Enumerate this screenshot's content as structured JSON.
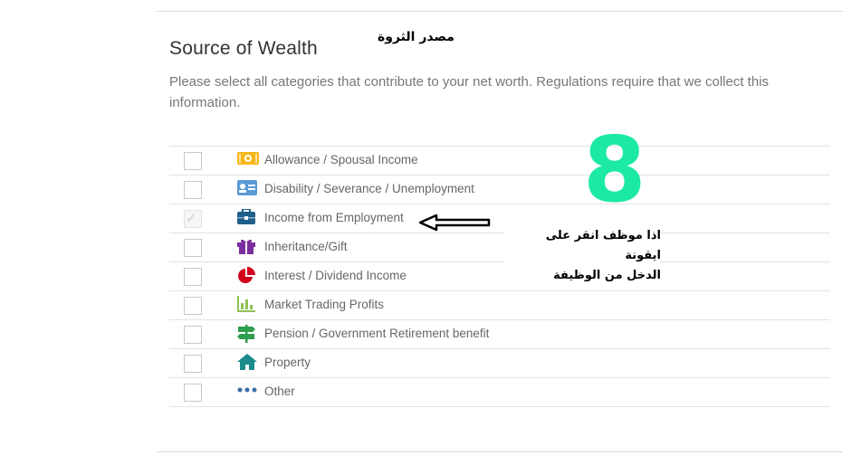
{
  "section": {
    "title": "Source of Wealth",
    "title_ar": "مصدر الثروة",
    "description": "Please select all categories that contribute to your net worth. Regulations require that we collect this information."
  },
  "options": [
    {
      "label": "Allowance / Spousal Income",
      "icon": "banknote-icon",
      "checked": false
    },
    {
      "label": "Disability / Severance / Unemployment",
      "icon": "id-card-icon",
      "checked": false
    },
    {
      "label": "Income from Employment",
      "icon": "briefcase-icon",
      "checked": true
    },
    {
      "label": "Inheritance/Gift",
      "icon": "gift-icon",
      "checked": false
    },
    {
      "label": "Interest / Dividend Income",
      "icon": "pie-chart-icon",
      "checked": false
    },
    {
      "label": "Market Trading Profits",
      "icon": "bar-chart-icon",
      "checked": false
    },
    {
      "label": "Pension / Government Retirement benefit",
      "icon": "signpost-icon",
      "checked": false
    },
    {
      "label": "Property",
      "icon": "house-icon",
      "checked": false
    },
    {
      "label": "Other",
      "icon": "more-dots-icon",
      "checked": false
    }
  ],
  "annotation": {
    "step_number": "8",
    "note_line1": "اذا موظف انقر على ايقونة",
    "note_line2": "الدخل من الوظيفة"
  },
  "colors": {
    "banknote": "#f5b81c",
    "id_card": "#5b9bd5",
    "briefcase": "#1f5f8b",
    "gift": "#7a2d9c",
    "pie": "#d0021b",
    "bar_chart": "#8cc152",
    "signpost": "#2e9e4f",
    "house": "#1a8a8a",
    "dots": "#3a6ea5",
    "step_number": "#1de9a6"
  }
}
